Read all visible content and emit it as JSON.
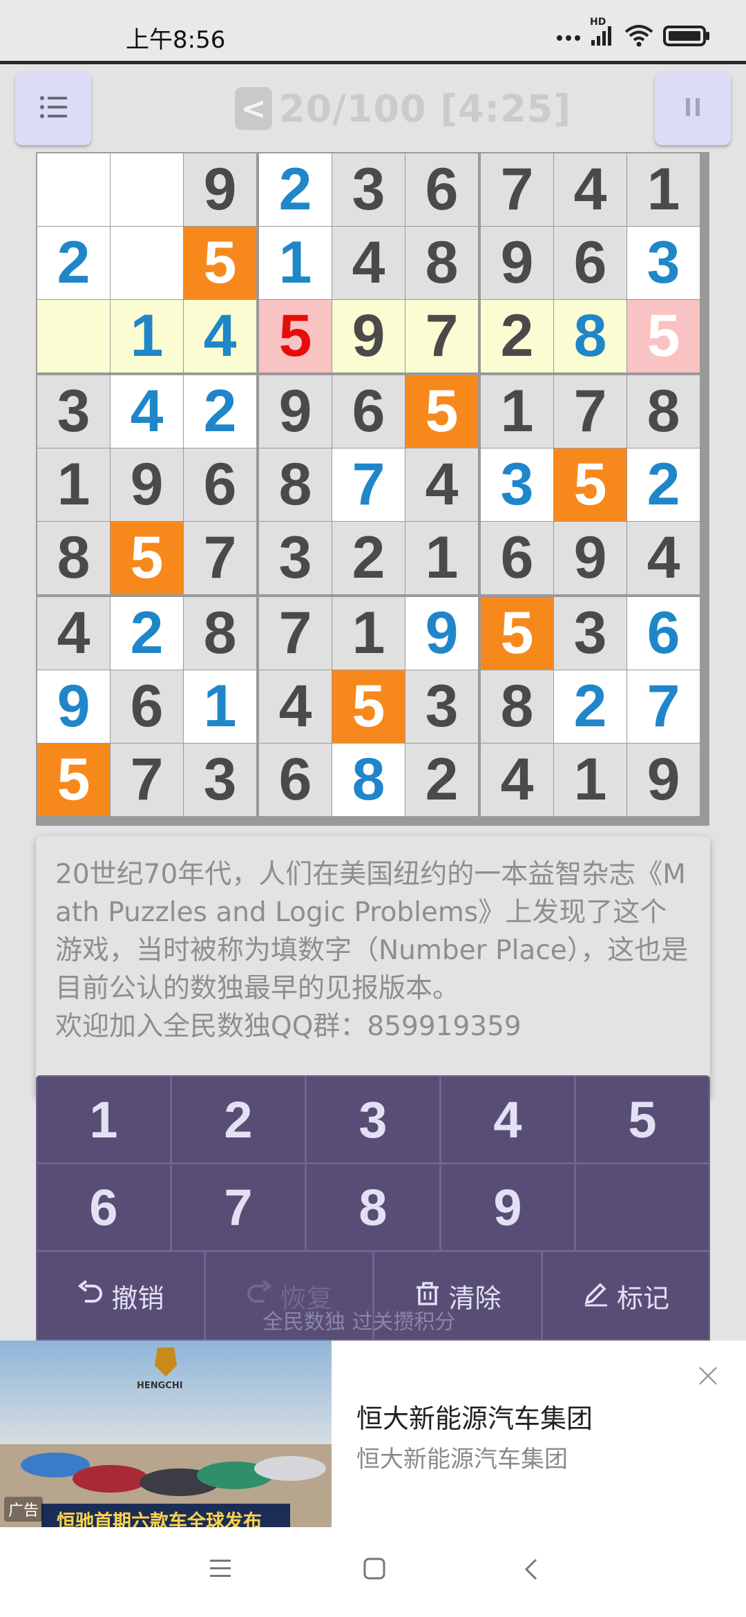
{
  "status_bar": {
    "time": "上午8:56",
    "network_label": "HD"
  },
  "header": {
    "back_label": "<",
    "level_text": "20/100 [4:25]"
  },
  "grid": {
    "cells": [
      [
        {
          "v": "",
          "bg": "white",
          "c": "given"
        },
        {
          "v": "",
          "bg": "white",
          "c": "given"
        },
        {
          "v": "9",
          "bg": "gray",
          "c": "given"
        },
        {
          "v": "2",
          "bg": "white",
          "c": "user"
        },
        {
          "v": "3",
          "bg": "gray",
          "c": "given"
        },
        {
          "v": "6",
          "bg": "gray",
          "c": "given"
        },
        {
          "v": "7",
          "bg": "gray",
          "c": "given"
        },
        {
          "v": "4",
          "bg": "gray",
          "c": "given"
        },
        {
          "v": "1",
          "bg": "gray",
          "c": "given"
        }
      ],
      [
        {
          "v": "2",
          "bg": "white",
          "c": "user"
        },
        {
          "v": "",
          "bg": "white",
          "c": "given"
        },
        {
          "v": "5",
          "bg": "orange",
          "c": "white"
        },
        {
          "v": "1",
          "bg": "white",
          "c": "user"
        },
        {
          "v": "4",
          "bg": "gray",
          "c": "given"
        },
        {
          "v": "8",
          "bg": "gray",
          "c": "given"
        },
        {
          "v": "9",
          "bg": "gray",
          "c": "given"
        },
        {
          "v": "6",
          "bg": "gray",
          "c": "given"
        },
        {
          "v": "3",
          "bg": "white",
          "c": "user"
        }
      ],
      [
        {
          "v": "",
          "bg": "yellow",
          "c": "given"
        },
        {
          "v": "1",
          "bg": "yellow",
          "c": "user"
        },
        {
          "v": "4",
          "bg": "yellow",
          "c": "user"
        },
        {
          "v": "5",
          "bg": "pink",
          "c": "error"
        },
        {
          "v": "9",
          "bg": "yellow",
          "c": "given"
        },
        {
          "v": "7",
          "bg": "yellow",
          "c": "given"
        },
        {
          "v": "2",
          "bg": "yellow",
          "c": "given"
        },
        {
          "v": "8",
          "bg": "yellow",
          "c": "user"
        },
        {
          "v": "5",
          "bg": "pink",
          "c": "pinkwhite"
        }
      ],
      [
        {
          "v": "3",
          "bg": "gray",
          "c": "given"
        },
        {
          "v": "4",
          "bg": "white",
          "c": "user"
        },
        {
          "v": "2",
          "bg": "white",
          "c": "user"
        },
        {
          "v": "9",
          "bg": "gray",
          "c": "given"
        },
        {
          "v": "6",
          "bg": "gray",
          "c": "given"
        },
        {
          "v": "5",
          "bg": "orange",
          "c": "white"
        },
        {
          "v": "1",
          "bg": "gray",
          "c": "given"
        },
        {
          "v": "7",
          "bg": "gray",
          "c": "given"
        },
        {
          "v": "8",
          "bg": "gray",
          "c": "given"
        }
      ],
      [
        {
          "v": "1",
          "bg": "gray",
          "c": "given"
        },
        {
          "v": "9",
          "bg": "gray",
          "c": "given"
        },
        {
          "v": "6",
          "bg": "gray",
          "c": "given"
        },
        {
          "v": "8",
          "bg": "gray",
          "c": "given"
        },
        {
          "v": "7",
          "bg": "white",
          "c": "user"
        },
        {
          "v": "4",
          "bg": "gray",
          "c": "given"
        },
        {
          "v": "3",
          "bg": "white",
          "c": "user"
        },
        {
          "v": "5",
          "bg": "orange",
          "c": "white"
        },
        {
          "v": "2",
          "bg": "white",
          "c": "user"
        }
      ],
      [
        {
          "v": "8",
          "bg": "gray",
          "c": "given"
        },
        {
          "v": "5",
          "bg": "orange",
          "c": "white"
        },
        {
          "v": "7",
          "bg": "gray",
          "c": "given"
        },
        {
          "v": "3",
          "bg": "gray",
          "c": "given"
        },
        {
          "v": "2",
          "bg": "gray",
          "c": "given"
        },
        {
          "v": "1",
          "bg": "gray",
          "c": "given"
        },
        {
          "v": "6",
          "bg": "gray",
          "c": "given"
        },
        {
          "v": "9",
          "bg": "gray",
          "c": "given"
        },
        {
          "v": "4",
          "bg": "gray",
          "c": "given"
        }
      ],
      [
        {
          "v": "4",
          "bg": "gray",
          "c": "given"
        },
        {
          "v": "2",
          "bg": "white",
          "c": "user"
        },
        {
          "v": "8",
          "bg": "gray",
          "c": "given"
        },
        {
          "v": "7",
          "bg": "gray",
          "c": "given"
        },
        {
          "v": "1",
          "bg": "gray",
          "c": "given"
        },
        {
          "v": "9",
          "bg": "white",
          "c": "user"
        },
        {
          "v": "5",
          "bg": "orange",
          "c": "white"
        },
        {
          "v": "3",
          "bg": "gray",
          "c": "given"
        },
        {
          "v": "6",
          "bg": "white",
          "c": "user"
        }
      ],
      [
        {
          "v": "9",
          "bg": "white",
          "c": "user"
        },
        {
          "v": "6",
          "bg": "gray",
          "c": "given"
        },
        {
          "v": "1",
          "bg": "white",
          "c": "user"
        },
        {
          "v": "4",
          "bg": "gray",
          "c": "given"
        },
        {
          "v": "5",
          "bg": "orange",
          "c": "white"
        },
        {
          "v": "3",
          "bg": "gray",
          "c": "given"
        },
        {
          "v": "8",
          "bg": "gray",
          "c": "given"
        },
        {
          "v": "2",
          "bg": "white",
          "c": "user"
        },
        {
          "v": "7",
          "bg": "white",
          "c": "user"
        }
      ],
      [
        {
          "v": "5",
          "bg": "orange",
          "c": "white"
        },
        {
          "v": "7",
          "bg": "gray",
          "c": "given"
        },
        {
          "v": "3",
          "bg": "gray",
          "c": "given"
        },
        {
          "v": "6",
          "bg": "gray",
          "c": "given"
        },
        {
          "v": "8",
          "bg": "white",
          "c": "user"
        },
        {
          "v": "2",
          "bg": "gray",
          "c": "given"
        },
        {
          "v": "4",
          "bg": "gray",
          "c": "given"
        },
        {
          "v": "1",
          "bg": "gray",
          "c": "given"
        },
        {
          "v": "9",
          "bg": "gray",
          "c": "given"
        }
      ]
    ]
  },
  "info_panel": {
    "text": "20世纪70年代，人们在美国纽约的一本益智杂志《Math Puzzles and Logic Problems》上发现了这个游戏，当时被称为填数字（Number Place），这也是目前公认的数独最早的见报版本。",
    "group": "欢迎加入全民数独QQ群：859919359"
  },
  "keypad": {
    "digits": [
      "1",
      "2",
      "3",
      "4",
      "5",
      "6",
      "7",
      "8",
      "9"
    ],
    "undo_label": "撤销",
    "redo_label": "恢复",
    "clear_label": "清除",
    "mark_label": "标记"
  },
  "overlay_text": "全民数独 过关攒积分",
  "ad": {
    "image_caption": "恒驰首期六款车全球发布",
    "brand_logo_text": "HENGCHI",
    "tag": "广告",
    "title": "恒大新能源汽车集团",
    "subtitle": "恒大新能源汽车集团"
  },
  "colors": {
    "given": "#4a4a4a",
    "user": "#1f86c9",
    "error": "#e60d0d",
    "orange": "#f7891c",
    "keypad": "#574d75"
  }
}
